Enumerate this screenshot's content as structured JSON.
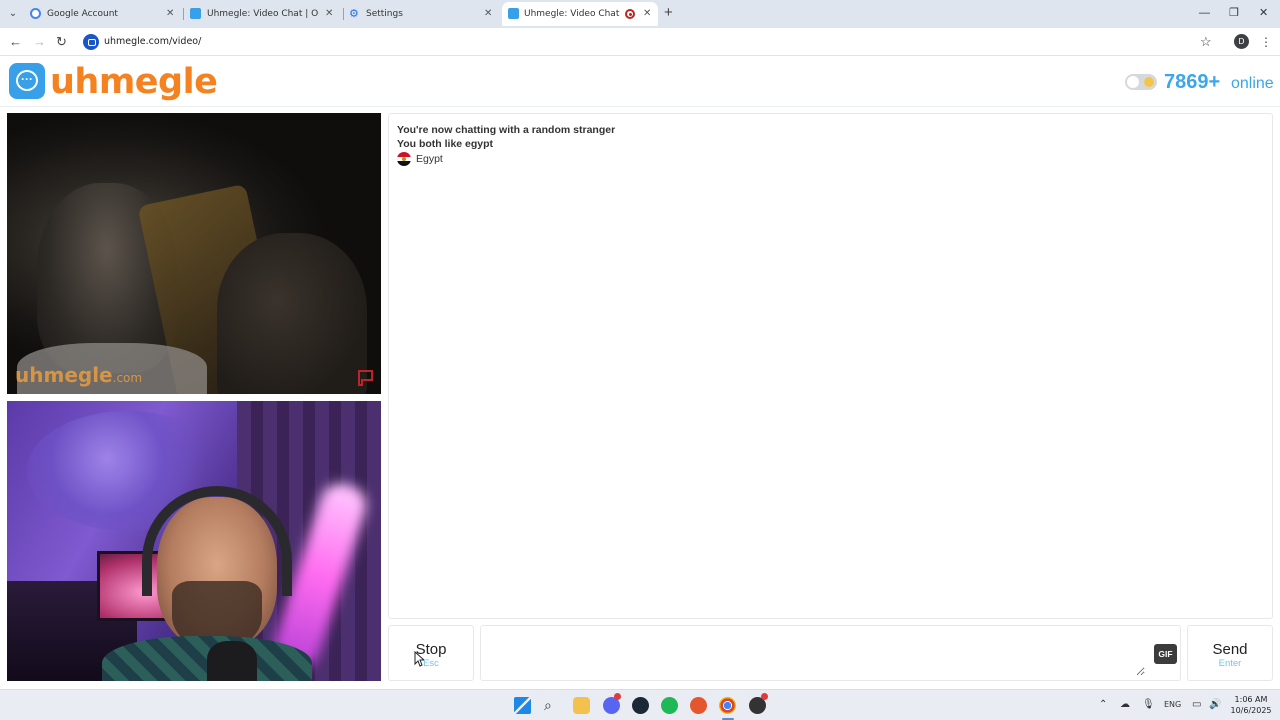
{
  "browser": {
    "tabs": [
      {
        "title": "Google Account",
        "favicon_color": "#4285f4"
      },
      {
        "title": "Uhmegle: Video Chat | Omegle",
        "favicon_color": "#37a0e8"
      },
      {
        "title": "Settings",
        "favicon_color": "#1a73e8"
      },
      {
        "title": "Uhmegle: Video Chat | Omegle",
        "favicon_color": "#37a0e8",
        "active": true,
        "recording": true
      }
    ],
    "new_tab_symbol": "+",
    "url": "uhmegle.com/video/",
    "profile_initial": "D"
  },
  "header": {
    "logo_text": "uhmegle",
    "online_count": "7869+",
    "online_label": "online",
    "accent_color": "#f58220",
    "count_color": "#3ba6e8"
  },
  "remote_video": {
    "watermark": "uhmegle",
    "watermark_suffix": ".com"
  },
  "chat": {
    "messages": [
      "You're now chatting with a random stranger",
      "You both like egypt"
    ],
    "country": "Egypt"
  },
  "controls": {
    "stop_label": "Stop",
    "stop_hint": "Esc",
    "send_label": "Send",
    "send_hint": "Enter",
    "gif_label": "GIF",
    "message_value": ""
  },
  "taskbar": {
    "language": "ENG",
    "time": "1:06 AM",
    "date": "10/6/2025"
  }
}
